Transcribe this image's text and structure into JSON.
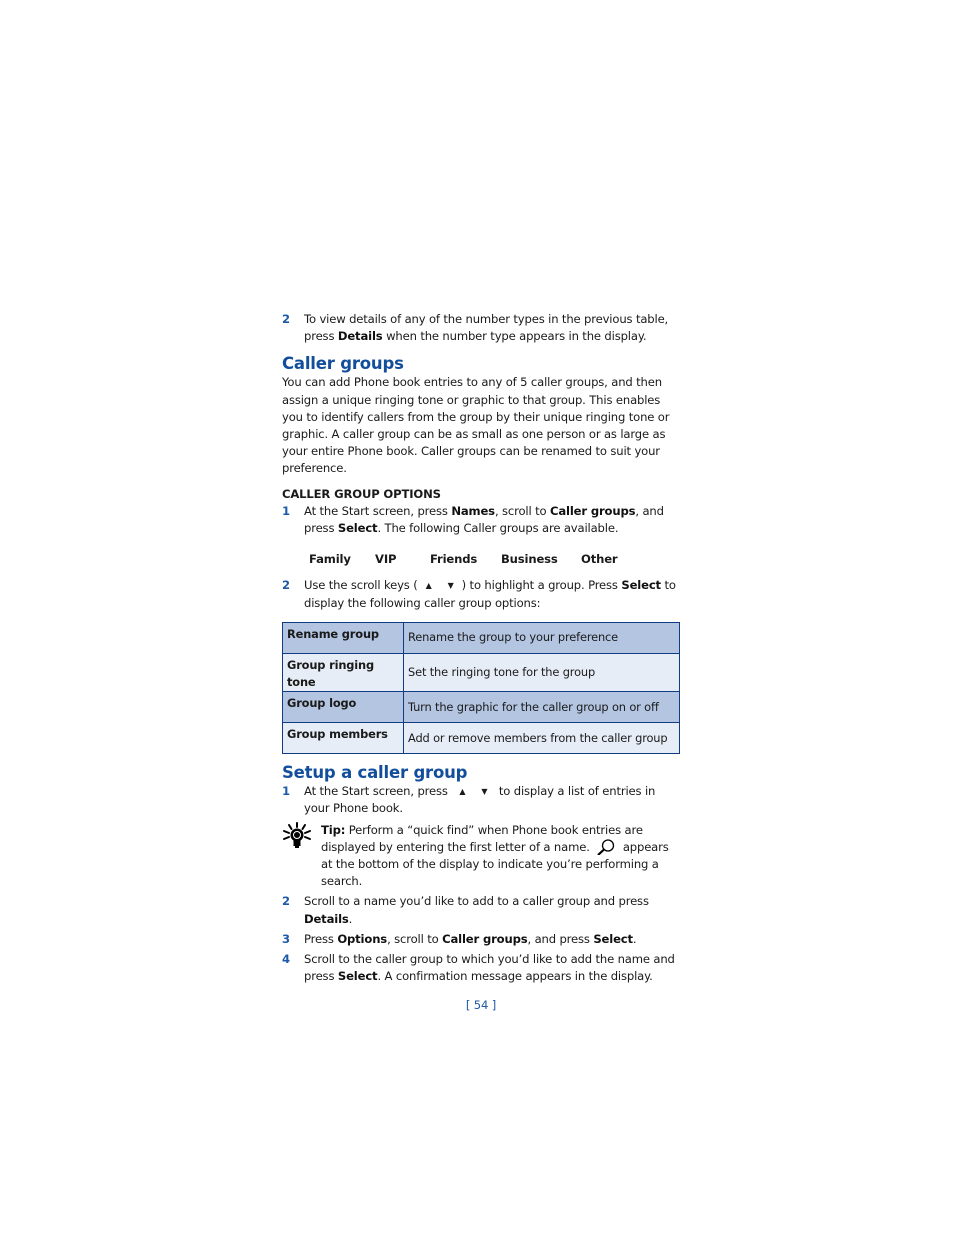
{
  "intro_step": {
    "number": "2",
    "text_before": "To view details of any of the number types in the previous table, press ",
    "bold": "Details",
    "text_after": " when the number type appears in the display."
  },
  "caller_groups": {
    "heading": "Caller groups",
    "body": "You can add Phone book entries to any of 5 caller groups, and then assign a unique ringing tone or graphic to that group. This enables you to identify callers from the group by their unique ringing tone or graphic. A caller group can be as small as one person or as large as your entire Phone book. Caller groups can be renamed to suit your preference.",
    "subheading": "CALLER GROUP OPTIONS",
    "step1": {
      "number": "1",
      "t1": "At the Start screen, press ",
      "b1": "Names",
      "t2": ", scroll to ",
      "b2": "Caller groups",
      "t3": ", and press ",
      "b3": "Select",
      "t4": ". The following Caller groups are available."
    },
    "groups": [
      "Family",
      "VIP",
      "Friends",
      "Business",
      "Other"
    ],
    "step2": {
      "number": "2",
      "t1": "Use the scroll keys (",
      "up_icon": "▲",
      "down_icon": "▼",
      "t2": ") to highlight a group. Press ",
      "b1": "Select",
      "t3": " to display the following caller group options:"
    },
    "options_table": [
      {
        "option": "Rename group",
        "description": "Rename the group to your preference"
      },
      {
        "option": "Group ringing tone",
        "description": "Set the ringing tone for the group"
      },
      {
        "option": "Group logo",
        "description": "Turn the graphic for the caller group on or off"
      },
      {
        "option": "Group members",
        "description": "Add or remove members from the caller group"
      }
    ]
  },
  "setup": {
    "heading": "Setup a caller group",
    "step1": {
      "number": "1",
      "t1": "At the Start screen, press ",
      "up_icon": "▲",
      "down_icon": "▼",
      "t2": " to display a list of entries in your Phone book."
    },
    "tip": {
      "label": "Tip:",
      "t1": " Perform a “quick find” when Phone book entries are displayed by entering the first letter of a name. ",
      "t2": " appears at the bottom of the display to indicate you’re performing a search."
    },
    "step2": {
      "number": "2",
      "t1": "Scroll to a name you’d like to add to a caller group and press ",
      "b1": "Details",
      "t2": "."
    },
    "step3": {
      "number": "3",
      "t1": "Press ",
      "b1": "Options",
      "t2": ", scroll to ",
      "b2": "Caller groups",
      "t3": ", and press ",
      "b3": "Select",
      "t4": "."
    },
    "step4": {
      "number": "4",
      "t1": "Scroll to the caller group to which you’d like to add the name and press ",
      "b1": "Select",
      "t2": ". A confirmation message appears in the display."
    }
  },
  "page_number": "[ 54 ]",
  "colors": {
    "heading": "#124e9c",
    "step_number": "#1d5aa8",
    "table_dark": "#b3c5e1",
    "table_light": "#e7edf7",
    "table_border": "#0f3c82"
  }
}
